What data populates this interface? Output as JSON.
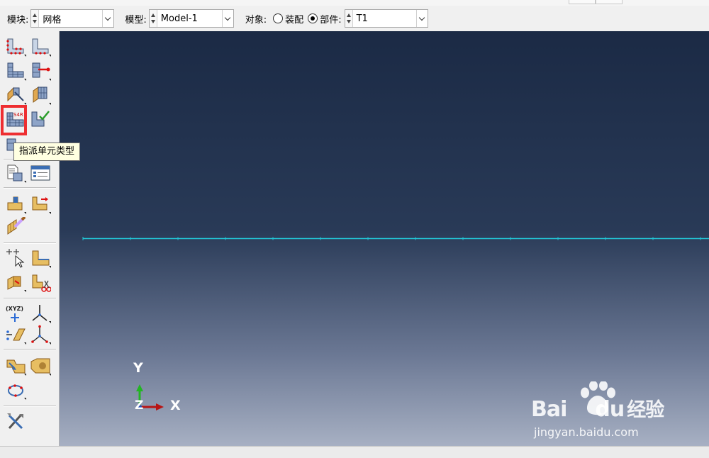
{
  "context_bar": {
    "module_label": "模块:",
    "module_value": "网格",
    "model_label": "模型:",
    "model_value": "Model-1",
    "object_label": "对象:",
    "assembly_option": "装配",
    "part_option": "部件:",
    "part_value": "T1",
    "selected_object": "part"
  },
  "toolbox": {
    "tooltip": "指派单元类型",
    "element_type_badge": "S4R",
    "coord_label": "(XYZ)"
  },
  "viewport": {
    "triad": {
      "x_label": "X",
      "y_label": "Y",
      "z_label": "Z"
    },
    "colors": {
      "background_top": "#1b2a45",
      "background_bottom": "#a7b0c3",
      "mesh_line": "#22c8d8"
    }
  },
  "watermark": {
    "brand": "Bai",
    "brand2": "du",
    "brand_cn": "经验",
    "site": "jingyan.baidu.com"
  },
  "icons": [
    "seed-part-icon",
    "seed-edge-icon",
    "mesh-controls-icon",
    "bias-seed-icon",
    "mesh-part-icon",
    "mesh-region-icon",
    "assign-element-type-icon",
    "verify-mesh-icon",
    "mesh-stack-icon",
    "query-mesh-icon",
    "mesh-table-icon",
    "edit-mesh-icon",
    "move-node-icon",
    "edit-region-icon",
    "pick-node-icon",
    "sweep-region-icon",
    "partition-cell-icon",
    "cut-cell-icon",
    "create-point-icon",
    "datum-axis-icon",
    "datum-plane-icon",
    "datum-csys-icon",
    "virtual-topology-icon",
    "repair-icon",
    "loop-icon",
    "tools-icon"
  ]
}
